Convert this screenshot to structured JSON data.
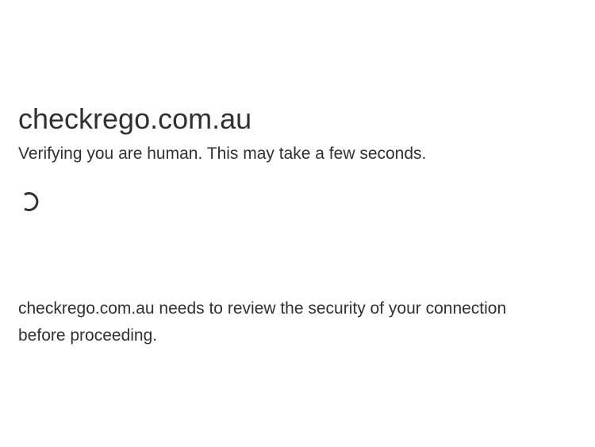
{
  "page": {
    "site_title": "checkrego.com.au",
    "verify_message": "Verifying you are human. This may take a few seconds.",
    "loading_icon": "spinner-icon",
    "review_message": "checkrego.com.au needs to review the security of your connection before proceeding."
  },
  "colors": {
    "text": "#313131",
    "background": "#ffffff",
    "spinner": "#313131"
  }
}
